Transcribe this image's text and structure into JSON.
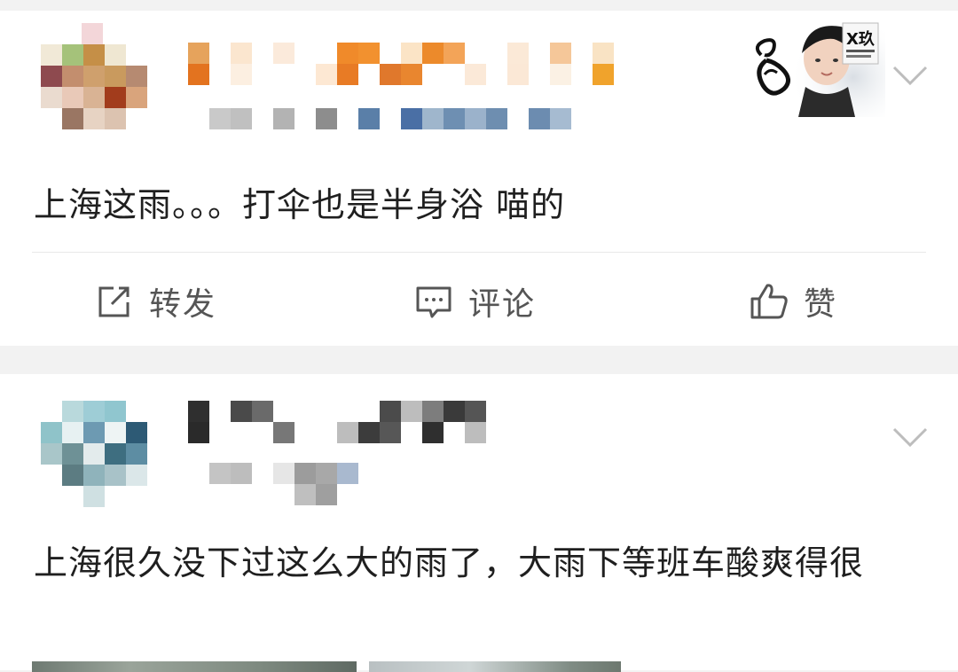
{
  "posts": [
    {
      "author_badge_text": "X玖",
      "text": "上海这雨。。。打伞也是半身浴  喵的",
      "actions": {
        "repost_label": "转发",
        "comment_label": "评论",
        "like_label": "赞"
      }
    },
    {
      "text": "上海很久没下过这么大的雨了，大雨下等班车酸爽得很"
    }
  ],
  "icons": [
    "repost-icon",
    "comment-icon",
    "like-icon",
    "chevron-down-icon"
  ],
  "colors": {
    "page_background": "#f2f2f2",
    "card_background": "#ffffff",
    "text": "#1f1f1f",
    "action_text": "#555555"
  }
}
